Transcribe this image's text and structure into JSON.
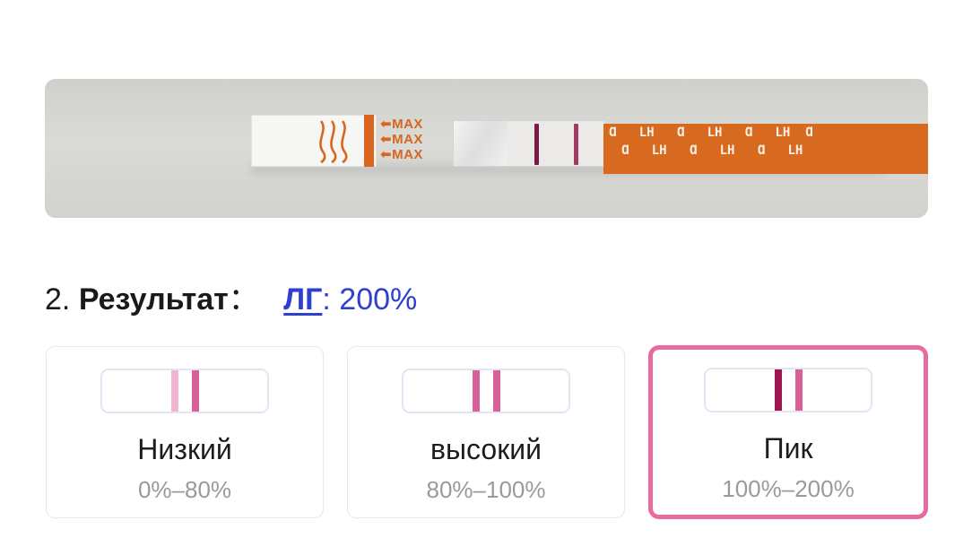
{
  "photo": {
    "strip_max_labels": [
      "MAX",
      "MAX",
      "MAX"
    ],
    "strip_marker_text": "LH",
    "test_line_color": "#7a1a45",
    "control_line_color": "#a33a66",
    "strip_orange": "#d76a1f"
  },
  "result": {
    "number": "2.",
    "label": "Результат",
    "separator": "：",
    "hormone_link": "ЛГ",
    "value": ": 200%"
  },
  "levels": [
    {
      "title": "Низкий",
      "range": "0%–80%",
      "selected": false,
      "test_line": "#f0b6cf",
      "control_line": "#d85f98"
    },
    {
      "title": "высокий",
      "range": "80%–100%",
      "selected": false,
      "test_line": "#d85f98",
      "control_line": "#d85f98"
    },
    {
      "title": "Пик",
      "range": "100%–200%",
      "selected": true,
      "test_line": "#9c1650",
      "control_line": "#d85f98"
    }
  ],
  "accent": "#e56ba0",
  "link_color": "#2f3fd0"
}
